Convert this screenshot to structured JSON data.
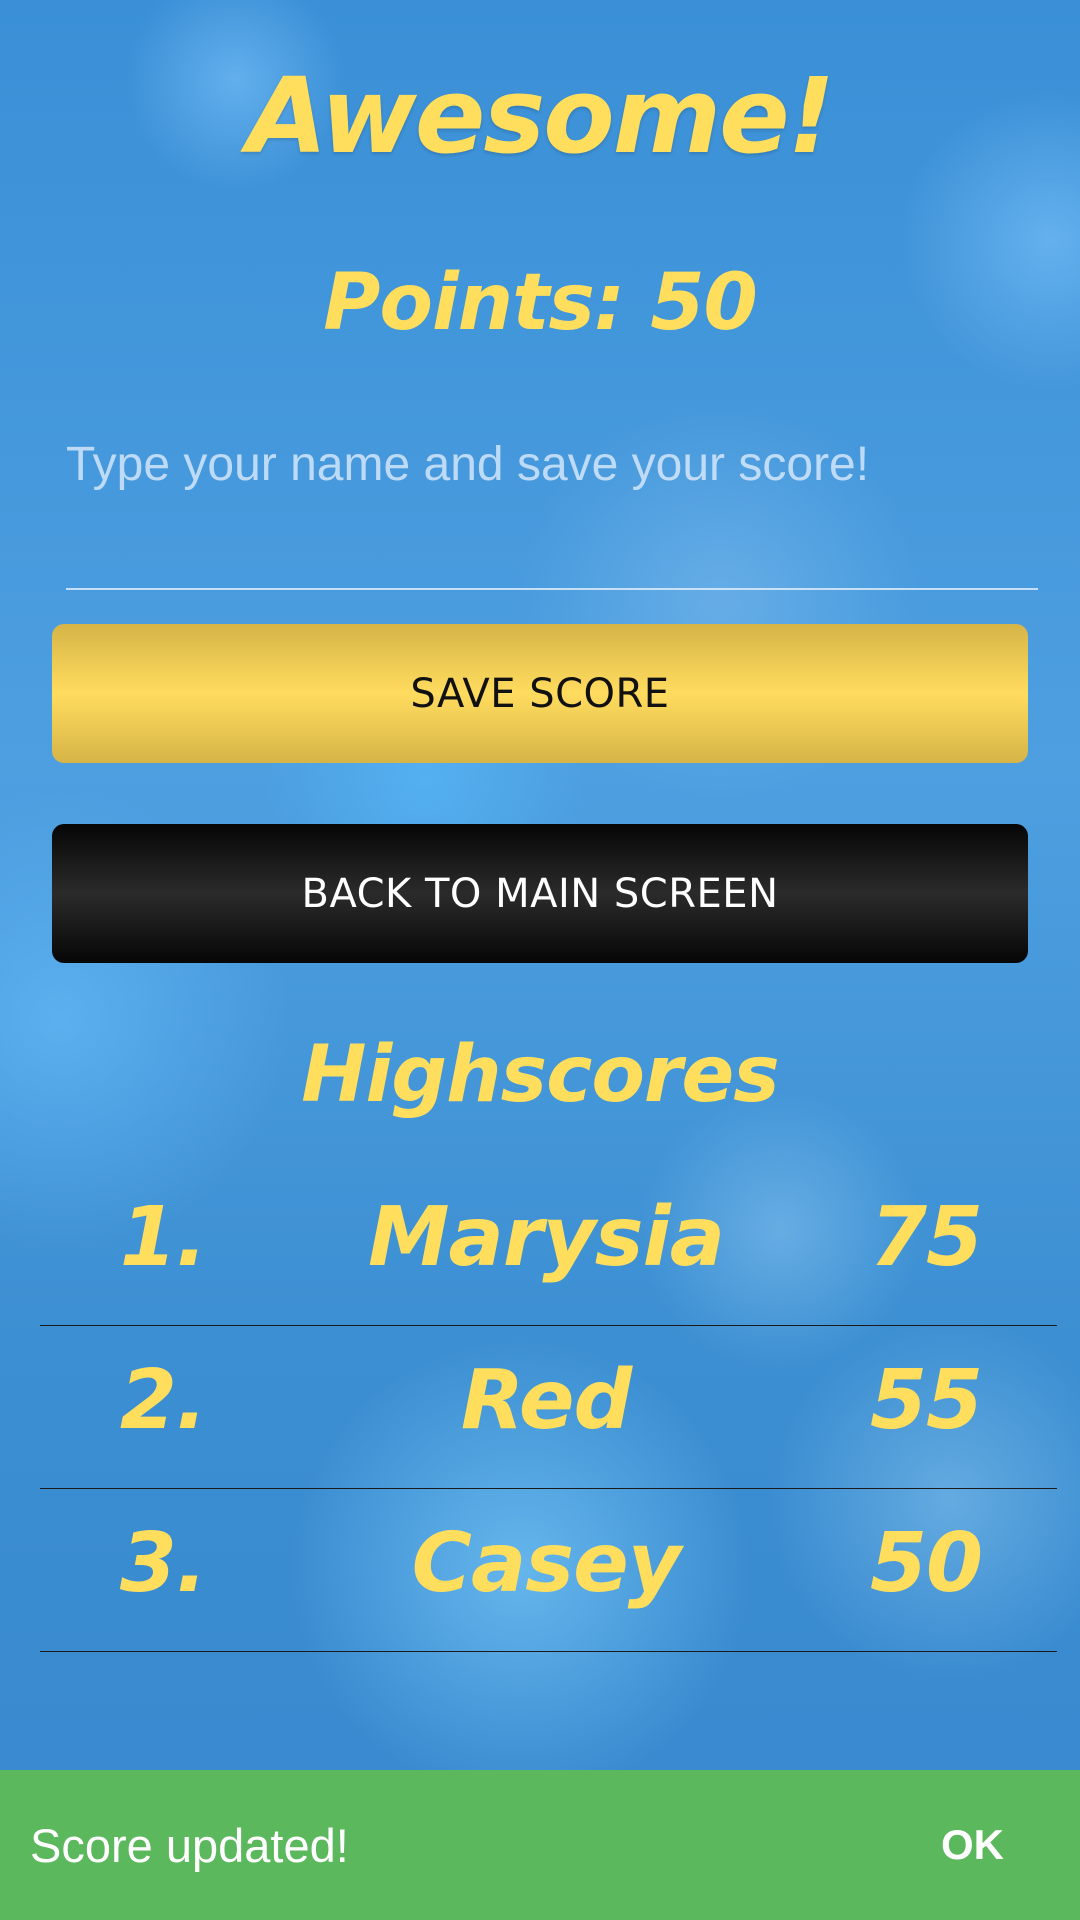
{
  "header": {
    "title": "Awesome!",
    "points": "Points: 50"
  },
  "form": {
    "name_placeholder": "Type your name and save your score!",
    "name_value": "",
    "save_label": "SAVE SCORE",
    "back_label": "BACK TO MAIN SCREEN"
  },
  "highscores": {
    "title": "Highscores",
    "rows": [
      {
        "rank": "1.",
        "name": "Marysia",
        "score": "75"
      },
      {
        "rank": "2.",
        "name": "Red",
        "score": "55"
      },
      {
        "rank": "3.",
        "name": "Casey",
        "score": "50"
      }
    ]
  },
  "snackbar": {
    "message": "Score updated!",
    "action": "OK"
  },
  "colors": {
    "accent_yellow": "#fede5c",
    "snackbar_green": "#5cb85c",
    "background_blue": "#3f94d8"
  }
}
